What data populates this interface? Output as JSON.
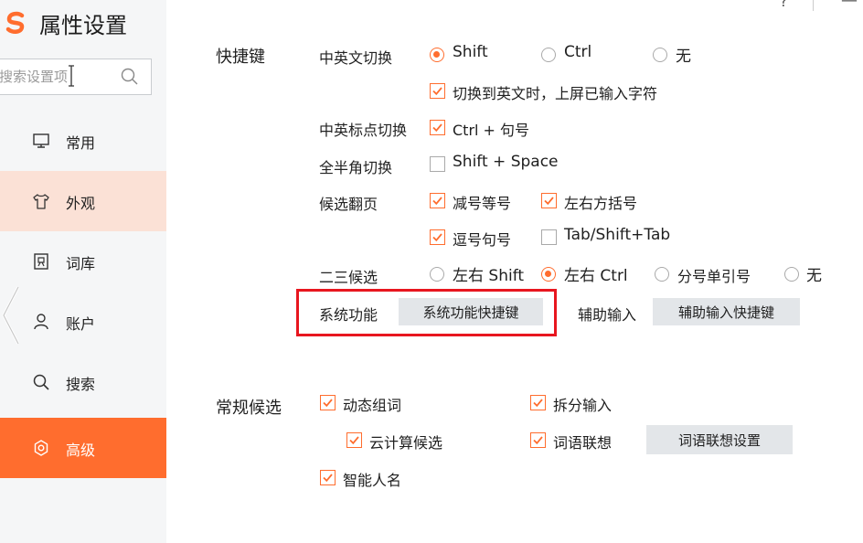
{
  "window": {
    "title": "属性设置",
    "help_symbol": "?",
    "minimize_symbol": "—"
  },
  "colors": {
    "accent": "#ff6d2e",
    "highlight_border": "#e8161f",
    "sidebar_bg": "#f5f6f7",
    "hover_bg": "#fbe1d6",
    "button_bg": "#e3e6e9"
  },
  "sidebar": {
    "search": {
      "placeholder": "搜索设置项",
      "icon": "search-icon"
    },
    "items": [
      {
        "label": "常用",
        "icon": "monitor-icon",
        "state": "normal"
      },
      {
        "label": "外观",
        "icon": "shirt-icon",
        "state": "hover"
      },
      {
        "label": "词库",
        "icon": "dictionary-icon",
        "state": "normal"
      },
      {
        "label": "账户",
        "icon": "user-icon",
        "state": "normal"
      },
      {
        "label": "搜索",
        "icon": "search-icon",
        "state": "normal"
      },
      {
        "label": "高级",
        "icon": "settings-icon",
        "state": "active"
      }
    ]
  },
  "shortcuts": {
    "title": "快捷键",
    "lang_switch": {
      "label": "中英文切换",
      "options": [
        {
          "label": "Shift",
          "selected": true
        },
        {
          "label": "Ctrl",
          "selected": false
        },
        {
          "label": "无",
          "selected": false
        }
      ],
      "commit_checkbox": {
        "label": "切换到英文时，上屏已输入字符",
        "checked": true
      }
    },
    "punct_switch": {
      "label": "中英标点切换",
      "checkbox": {
        "label": "Ctrl + 句号",
        "checked": true
      }
    },
    "width_switch": {
      "label": "全半角切换",
      "checkbox": {
        "label": "Shift + Space",
        "checked": false
      }
    },
    "page_turn": {
      "label": "候选翻页",
      "options": [
        {
          "label": "减号等号",
          "checked": true
        },
        {
          "label": "左右方括号",
          "checked": true
        },
        {
          "label": "逗号句号",
          "checked": true
        },
        {
          "label": "Tab/Shift+Tab",
          "checked": false
        }
      ]
    },
    "second_third": {
      "label": "二三候选",
      "options": [
        {
          "label": "左右 Shift",
          "selected": false
        },
        {
          "label": "左右 Ctrl",
          "selected": true
        },
        {
          "label": "分号单引号",
          "selected": false
        },
        {
          "label": "无",
          "selected": false
        }
      ]
    },
    "system_function": {
      "label": "系统功能",
      "button": "系统功能快捷键"
    },
    "aux_input": {
      "label": "辅助输入",
      "button": "辅助输入快捷键"
    }
  },
  "candidates": {
    "title": "常规候选",
    "options": [
      {
        "label": "动态组词",
        "checked": true
      },
      {
        "label": "拆分输入",
        "checked": true
      },
      {
        "label": "云计算候选",
        "checked": true
      },
      {
        "label": "词语联想",
        "checked": true
      },
      {
        "label": "智能人名",
        "checked": true
      }
    ],
    "assoc_button": "词语联想设置"
  }
}
